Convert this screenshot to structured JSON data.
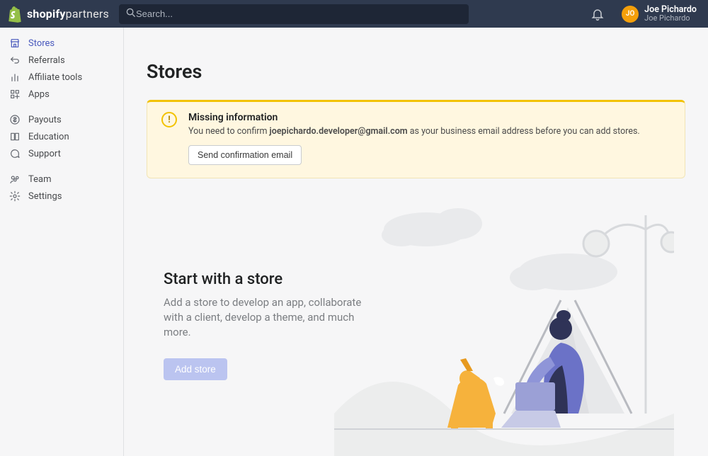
{
  "brand": {
    "word1": "shopify",
    "word2": "partners"
  },
  "search": {
    "placeholder": "Search..."
  },
  "user": {
    "initials": "JO",
    "name": "Joe Pichardo",
    "subtitle": "Joe Pichardo"
  },
  "sidebar": {
    "primary": [
      {
        "label": "Stores",
        "icon": "storefront",
        "active": true
      },
      {
        "label": "Referrals",
        "icon": "arrow-return",
        "active": false
      },
      {
        "label": "Affiliate tools",
        "icon": "bar-chart",
        "active": false
      },
      {
        "label": "Apps",
        "icon": "apps-grid",
        "active": false
      }
    ],
    "secondary": [
      {
        "label": "Payouts",
        "icon": "dollar"
      },
      {
        "label": "Education",
        "icon": "book"
      },
      {
        "label": "Support",
        "icon": "chat"
      }
    ],
    "tertiary": [
      {
        "label": "Team",
        "icon": "team"
      },
      {
        "label": "Settings",
        "icon": "gear"
      }
    ]
  },
  "page": {
    "title": "Stores",
    "banner": {
      "title": "Missing information",
      "msg_pre": "You need to confirm ",
      "email": "joepichardo.developer@gmail.com",
      "msg_post": " as your business email address before you can add stores.",
      "action": "Send confirmation email"
    },
    "empty": {
      "title": "Start with a store",
      "desc": "Add a store to develop an app, collaborate with a client, develop a theme, and much more.",
      "action": "Add store"
    }
  }
}
